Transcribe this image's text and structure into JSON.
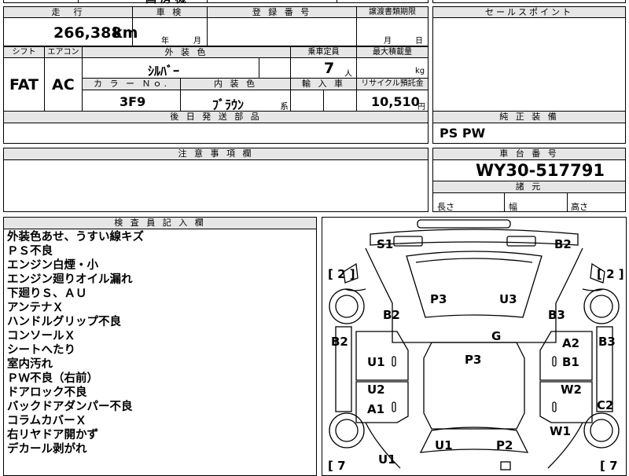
{
  "top": {
    "partial_text": "国 房 機"
  },
  "mileage": {
    "header": "走　行",
    "value": "266,388",
    "unit": "km"
  },
  "inspection": {
    "header": "車 検",
    "year_label": "年",
    "month_label": "月"
  },
  "registration": {
    "header": "登 録 番 号"
  },
  "transfer": {
    "header": "譲渡書類期限",
    "month_label": "月",
    "day_label": "日"
  },
  "sales_point": {
    "header": "セールスポイント"
  },
  "shift": {
    "header": "シフト",
    "value": "FAT"
  },
  "aircon": {
    "header": "エアコン",
    "value": "AC"
  },
  "exterior_color": {
    "header": "外 装 色",
    "value": "ｼﾙﾊﾞｰ"
  },
  "capacity": {
    "header": "乗車定員",
    "value": "7",
    "unit": "人"
  },
  "max_load": {
    "header": "最大積載量",
    "unit": "kg"
  },
  "color_no": {
    "header": "カ ラ ー Ｎｏ.",
    "value": "3F9"
  },
  "interior_color": {
    "header": "内 装 色",
    "value": "ﾌﾞﾗｳﾝ",
    "suffix": "系"
  },
  "import_car": {
    "header": "輸 入 車"
  },
  "recycle": {
    "header": "リサイクル預託金",
    "value": "10,510",
    "unit": "円"
  },
  "later_parts": {
    "header": "後 日 発 送 部 品"
  },
  "genuine_equipment": {
    "header": "純 正 装 備",
    "value": "PS PW"
  },
  "notes": {
    "header": "注 意 事 項 欄"
  },
  "chassis": {
    "header": "車 台 番 号",
    "value": "WY30-517791"
  },
  "dimensions": {
    "header": "諸 元",
    "length_label": "長さ",
    "width_label": "幅",
    "height_label": "高さ"
  },
  "inspector": {
    "header": "検 査 員 記 入 欄",
    "remarks": [
      "外装色あせ、うすい線キズ",
      "ＰＳ不良",
      "エンジン白煙・小",
      "エンジン廻りオイル漏れ",
      "下廻りＳ、ＡＵ",
      "アンテナＸ",
      "ハンドルグリップ不良",
      "コンソールＸ",
      "シートへたり",
      "室内汚れ",
      "ＰＷ不良（右前）",
      "ドアロック不良",
      "バックドアダンパー不良",
      "コラムカバーＸ",
      "右リヤドア開かず",
      "デカール剥がれ"
    ]
  },
  "diagram": {
    "bracket_left_top": "[ 2 ]",
    "bracket_right_top": "[ 2 ]",
    "bracket_left_bottom": "[ 7",
    "bracket_right_bottom": "[ 7",
    "labels": {
      "s1": "S1",
      "b2_top_right": "B2",
      "p3_left": "P3",
      "u3": "U3",
      "b2_left_mid": "B2",
      "b3_right_mid": "B3",
      "g": "G",
      "b2_far_left": "B2",
      "b3_far_right": "B3",
      "a2": "A2",
      "u1_left": "U1",
      "p3_center": "P3",
      "b1": "B1",
      "u2": "U2",
      "w2": "W2",
      "a1": "A1",
      "c2": "C2",
      "w1": "W1",
      "u1_bottom_center": "U1",
      "p2": "P2",
      "u1_bottom_left": "U1"
    }
  }
}
